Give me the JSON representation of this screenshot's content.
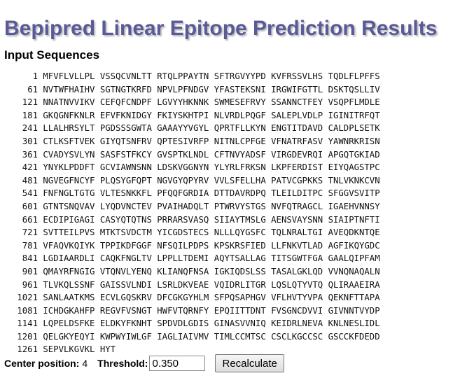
{
  "page": {
    "title": "Bepipred Linear Epitope Prediction Results",
    "section_heading": "Input Sequences"
  },
  "sequence": {
    "rows": [
      {
        "pos": "1",
        "chunks": [
          "MFVFLVLLPL",
          "VSSQCVNLTT",
          "RTQLPPAYTN",
          "SFTRGVYYPD",
          "KVFRSSVLHS",
          "TQDLFLPFFS"
        ]
      },
      {
        "pos": "61",
        "chunks": [
          "NVTWFHAIHV",
          "SGTNGTKRFD",
          "NPVLPFNDGV",
          "YFASTEKSNI",
          "IRGWIFGTTL",
          "DSKTQSLLIV"
        ]
      },
      {
        "pos": "121",
        "chunks": [
          "NNATNVVIKV",
          "CEFQFCNDPF",
          "LGVYYHKNNK",
          "SWMESEFRVY",
          "SSANNCTFEY",
          "VSQPFLMDLE"
        ]
      },
      {
        "pos": "181",
        "chunks": [
          "GKQGNFKNLR",
          "EFVFKNIDGY",
          "FKIYSKHTPI",
          "NLVRDLPQGF",
          "SALEPLVDLP",
          "IGINITRFQT"
        ]
      },
      {
        "pos": "241",
        "chunks": [
          "LLALHRSYLT",
          "PGDSSSGWTA",
          "GAAAYYVGYL",
          "QPRTFLLKYN",
          "ENGTITDAVD",
          "CALDPLSETK"
        ]
      },
      {
        "pos": "301",
        "chunks": [
          "CTLKSFTVEK",
          "GIYQTSNFRV",
          "QPTESIVRFP",
          "NITNLCPFGE",
          "VFNATRFASV",
          "YAWNRKRISN"
        ]
      },
      {
        "pos": "361",
        "chunks": [
          "CVADYSVLYN",
          "SASFSTFKCY",
          "GVSPTKLNDL",
          "CFTNVYADSF",
          "VIRGDEVRQI",
          "APGQTGKIAD"
        ]
      },
      {
        "pos": "421",
        "chunks": [
          "YNYKLPDDFT",
          "GCVIAWNSNN",
          "LDSKVGGNYN",
          "YLYRLFRKSN",
          "LKPFERDIST",
          "EIYQAGSTPC"
        ]
      },
      {
        "pos": "481",
        "chunks": [
          "NGVEGFNCYF",
          "PLQSYGFQPT",
          "NGVGYQPYRV",
          "VVLSFELLHA",
          "PATVCGPKKS",
          "TNLVKNKCVN"
        ]
      },
      {
        "pos": "541",
        "chunks": [
          "FNFNGLTGTG",
          "VLTESNKKFL",
          "PFQQFGRDIA",
          "DTTDAVRDPQ",
          "TLEILDITPC",
          "SFGGVSVITP"
        ]
      },
      {
        "pos": "601",
        "chunks": [
          "GTNTSNQVAV",
          "LYQDVNCTEV",
          "PVAIHADQLT",
          "PTWRVYSTGS",
          "NVFQTRAGCL",
          "IGAEHVNNSY"
        ]
      },
      {
        "pos": "661",
        "chunks": [
          "ECDIPIGAGI",
          "CASYQTQTNS",
          "PRRARSVASQ",
          "SIIAYTMSLG",
          "AENSVAYSNN",
          "SIAIPTNFTI"
        ]
      },
      {
        "pos": "721",
        "chunks": [
          "SVTTEILPVS",
          "MTKTSVDCTM",
          "YICGDSTECS",
          "NLLLQYGSFC",
          "TQLNRALTGI",
          "AVEQDKNTQE"
        ]
      },
      {
        "pos": "781",
        "chunks": [
          "VFAQVKQIYK",
          "TPPIKDFGGF",
          "NFSQILPDPS",
          "KPSKRSFIED",
          "LLFNKVTLAD",
          "AGFIKQYGDC"
        ]
      },
      {
        "pos": "841",
        "chunks": [
          "LGDIAARDLI",
          "CAQKFNGLTV",
          "LPPLLTDEMI",
          "AQYTSALLAG",
          "TITSGWTFGA",
          "GAALQIPFAM"
        ]
      },
      {
        "pos": "901",
        "chunks": [
          "QMAYRFNGIG",
          "VTQNVLYENQ",
          "KLIANQFNSA",
          "IGKIQDSLSS",
          "TASALGKLQD",
          "VVNQNAQALN"
        ]
      },
      {
        "pos": "961",
        "chunks": [
          "TLVKQLSSNF",
          "GAISSVLNDI",
          "LSRLDKVEAE",
          "VQIDRLITGR",
          "LQSLQTYVTQ",
          "QLIRAAEIRA"
        ]
      },
      {
        "pos": "1021",
        "chunks": [
          "SANLAATKMS",
          "ECVLGQSKRV",
          "DFCGKGYHLM",
          "SFPQSAPHGV",
          "VFLHVTYVPA",
          "QEKNFTTAPA"
        ]
      },
      {
        "pos": "1081",
        "chunks": [
          "ICHDGKAHFP",
          "REGVFVSNGT",
          "HWFVTQRNFY",
          "EPQIITTDNT",
          "FVSGNCDVVI",
          "GIVNNTVYDP"
        ]
      },
      {
        "pos": "1141",
        "chunks": [
          "LQPELDSFKE",
          "ELDKYFKNHT",
          "SPDVDLGDIS",
          "GINASVVNIQ",
          "KEIDRLNEVA",
          "KNLNESLIDL"
        ]
      },
      {
        "pos": "1201",
        "chunks": [
          "QELGKYEQYI",
          "KWPWYIWLGF",
          "IAGLIAIVMV",
          "TIMLCCMTSC",
          "CSCLKGCCSC",
          "GSCCKFDEDD"
        ]
      },
      {
        "pos": "1261",
        "chunks": [
          "SEPVLKGVKL",
          "HYT"
        ]
      }
    ]
  },
  "controls": {
    "center_label": "Center position:",
    "center_value": "4",
    "threshold_label": "Threshold:",
    "threshold_value": "0.350",
    "recalculate_label": "Recalculate"
  },
  "colors": {
    "title": "#5a5a99",
    "title_shadow": "#b8b8b8"
  }
}
